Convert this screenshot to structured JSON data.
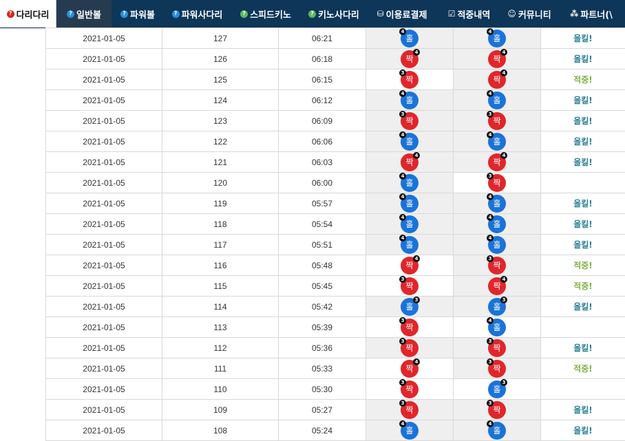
{
  "nav": [
    {
      "label": "다리다리",
      "icon": "question-icon",
      "color": "#d9251c",
      "active": true
    },
    {
      "label": "일반볼",
      "icon": "question-icon",
      "color": "#2a8fd8",
      "dark": true
    },
    {
      "label": "파워볼",
      "icon": "question-icon",
      "color": "#2a8fd8"
    },
    {
      "label": "파워사다리",
      "icon": "question-icon",
      "color": "#2a8fd8"
    },
    {
      "label": "스피드키노",
      "icon": "question-icon",
      "color": "#5cb85c"
    },
    {
      "label": "키노사다리",
      "icon": "question-icon",
      "color": "#5cb85c"
    },
    {
      "label": "이용료결제",
      "icon": "coins-icon",
      "glyph": "⛁"
    },
    {
      "label": "적중내역",
      "icon": "check-square-icon",
      "glyph": "☑"
    },
    {
      "label": "커뮤니티",
      "icon": "smile-icon",
      "glyph": "☺"
    },
    {
      "label": "파트너(\\",
      "icon": "cubes-icon",
      "glyph": "⁂"
    }
  ],
  "colors": {
    "odd": "#1a73d9",
    "even": "#e0262b",
    "win": "#2a7f95",
    "hit": "#7cb342"
  },
  "rows": [
    {
      "date": "2021-01-05",
      "round": "127",
      "time": "06:21",
      "b1": {
        "t": "홀",
        "n": "4",
        "pos": "l"
      },
      "b2": {
        "t": "홀",
        "n": "4",
        "pos": "l"
      },
      "result": "올킬!",
      "rtype": "teal"
    },
    {
      "date": "2021-01-05",
      "round": "126",
      "time": "06:18",
      "b1": {
        "t": "짝",
        "n": "4",
        "pos": "r"
      },
      "b2": {
        "t": "짝",
        "n": "4",
        "pos": "r"
      },
      "result": "올킬!",
      "rtype": "teal"
    },
    {
      "date": "2021-01-05",
      "round": "125",
      "time": "06:15",
      "b1": {
        "t": "짝",
        "n": "3",
        "pos": "l"
      },
      "b2": {
        "t": "짝",
        "n": "4",
        "pos": "r"
      },
      "result": "적중!",
      "rtype": "green"
    },
    {
      "date": "2021-01-05",
      "round": "124",
      "time": "06:12",
      "b1": {
        "t": "홀",
        "n": "4",
        "pos": "l"
      },
      "b2": {
        "t": "홀",
        "n": "4",
        "pos": "l"
      },
      "result": "올킬!",
      "rtype": "teal"
    },
    {
      "date": "2021-01-05",
      "round": "123",
      "time": "06:09",
      "b1": {
        "t": "짝",
        "n": "3",
        "pos": "l"
      },
      "b2": {
        "t": "짝",
        "n": "3",
        "pos": "l"
      },
      "result": "올킬!",
      "rtype": "teal"
    },
    {
      "date": "2021-01-05",
      "round": "122",
      "time": "06:06",
      "b1": {
        "t": "홀",
        "n": "4",
        "pos": "l"
      },
      "b2": {
        "t": "홀",
        "n": "4",
        "pos": "l"
      },
      "result": "올킬!",
      "rtype": "teal"
    },
    {
      "date": "2021-01-05",
      "round": "121",
      "time": "06:03",
      "b1": {
        "t": "짝",
        "n": "4",
        "pos": "r"
      },
      "b2": {
        "t": "짝",
        "n": "4",
        "pos": "r"
      },
      "result": "올킬!",
      "rtype": "teal"
    },
    {
      "date": "2021-01-05",
      "round": "120",
      "time": "06:00",
      "b1": {
        "t": "홀",
        "n": "4",
        "pos": "l"
      },
      "b2": {
        "t": "짝",
        "n": "3",
        "pos": "l"
      },
      "result": "",
      "rtype": ""
    },
    {
      "date": "2021-01-05",
      "round": "119",
      "time": "05:57",
      "b1": {
        "t": "홀",
        "n": "4",
        "pos": "l"
      },
      "b2": {
        "t": "홀",
        "n": "4",
        "pos": "l"
      },
      "result": "올킬!",
      "rtype": "teal"
    },
    {
      "date": "2021-01-05",
      "round": "118",
      "time": "05:54",
      "b1": {
        "t": "홀",
        "n": "4",
        "pos": "l"
      },
      "b2": {
        "t": "홀",
        "n": "4",
        "pos": "l"
      },
      "result": "올킬!",
      "rtype": "teal"
    },
    {
      "date": "2021-01-05",
      "round": "117",
      "time": "05:51",
      "b1": {
        "t": "홀",
        "n": "4",
        "pos": "l"
      },
      "b2": {
        "t": "홀",
        "n": "4",
        "pos": "l"
      },
      "result": "올킬!",
      "rtype": "teal"
    },
    {
      "date": "2021-01-05",
      "round": "116",
      "time": "05:48",
      "b1": {
        "t": "짝",
        "n": "4",
        "pos": "r"
      },
      "b2": {
        "t": "짝",
        "n": "3",
        "pos": "l"
      },
      "result": "적중!",
      "rtype": "green"
    },
    {
      "date": "2021-01-05",
      "round": "115",
      "time": "05:45",
      "b1": {
        "t": "짝",
        "n": "3",
        "pos": "l"
      },
      "b2": {
        "t": "짝",
        "n": "4",
        "pos": "r"
      },
      "result": "적중!",
      "rtype": "green"
    },
    {
      "date": "2021-01-05",
      "round": "114",
      "time": "05:42",
      "b1": {
        "t": "홀",
        "n": "3",
        "pos": "r"
      },
      "b2": {
        "t": "홀",
        "n": "3",
        "pos": "r"
      },
      "result": "올킬!",
      "rtype": "teal"
    },
    {
      "date": "2021-01-05",
      "round": "113",
      "time": "05:39",
      "b1": {
        "t": "짝",
        "n": "3",
        "pos": "l"
      },
      "b2": {
        "t": "홀",
        "n": "4",
        "pos": "l"
      },
      "result": "",
      "rtype": ""
    },
    {
      "date": "2021-01-05",
      "round": "112",
      "time": "05:36",
      "b1": {
        "t": "짝",
        "n": "3",
        "pos": "l"
      },
      "b2": {
        "t": "짝",
        "n": "3",
        "pos": "l"
      },
      "result": "올킬!",
      "rtype": "teal"
    },
    {
      "date": "2021-01-05",
      "round": "111",
      "time": "05:33",
      "b1": {
        "t": "짝",
        "n": "4",
        "pos": "r"
      },
      "b2": {
        "t": "짝",
        "n": "3",
        "pos": "l"
      },
      "result": "적중!",
      "rtype": "green"
    },
    {
      "date": "2021-01-05",
      "round": "110",
      "time": "05:30",
      "b1": {
        "t": "짝",
        "n": "3",
        "pos": "l"
      },
      "b2": {
        "t": "홀",
        "n": "3",
        "pos": "r"
      },
      "result": "",
      "rtype": ""
    },
    {
      "date": "2021-01-05",
      "round": "109",
      "time": "05:27",
      "b1": {
        "t": "짝",
        "n": "3",
        "pos": "l"
      },
      "b2": {
        "t": "짝",
        "n": "3",
        "pos": "l"
      },
      "result": "올킬!",
      "rtype": "teal"
    },
    {
      "date": "2021-01-05",
      "round": "108",
      "time": "05:24",
      "b1": {
        "t": "홀",
        "n": "4",
        "pos": "l"
      },
      "b2": {
        "t": "홀",
        "n": "4",
        "pos": "l"
      },
      "result": "올킬!",
      "rtype": "teal"
    }
  ]
}
